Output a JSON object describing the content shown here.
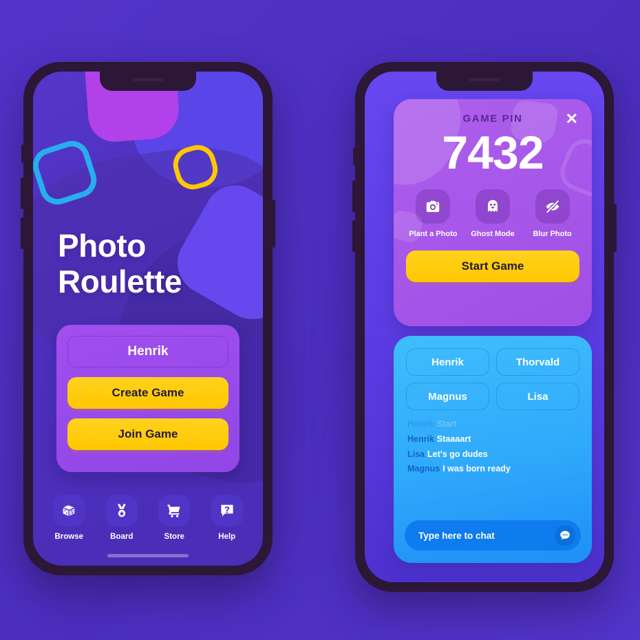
{
  "background": {
    "color": "#4E30C4"
  },
  "theme": {
    "accent_yellow": "#FFC700",
    "purple_panel": "#9B49E9",
    "chat_blue": "#2FA9FB",
    "phone_frame": "#2C1736",
    "ring_blue": "#28ADEE",
    "ring_yellow": "#FFC800",
    "blob_magenta": "#B141E8"
  },
  "left_phone": {
    "title_line1": "Photo",
    "title_line2": "Roulette",
    "panel": {
      "name_value": "Henrik",
      "name_placeholder": "Henrik",
      "create_label": "Create Game",
      "join_label": "Join Game"
    },
    "tabbar": [
      {
        "label": "Browse",
        "icon": "dice-icon"
      },
      {
        "label": "Board",
        "icon": "medal-icon"
      },
      {
        "label": "Store",
        "icon": "cart-icon"
      },
      {
        "label": "Help",
        "icon": "question-bubble-icon"
      }
    ]
  },
  "right_phone": {
    "pin_card": {
      "heading": "GAME PIN",
      "pin": "7432",
      "close_label": "✕",
      "modes": [
        {
          "label": "Plant a Photo",
          "icon": "camera-icon"
        },
        {
          "label": "Ghost Mode",
          "icon": "ghost-icon"
        },
        {
          "label": "Blur Photo",
          "icon": "eye-slash-icon"
        }
      ],
      "start_label": "Start Game"
    },
    "chat_card": {
      "players": [
        "Henrik",
        "Thorvald",
        "Magnus",
        "Lisa"
      ],
      "messages": [
        {
          "who": "Henrik",
          "text": "Start",
          "faded": true
        },
        {
          "who": "Henrik",
          "text": "Staaaart",
          "faded": false
        },
        {
          "who": "Lisa",
          "text": "Let's go dudes",
          "faded": false
        },
        {
          "who": "Magnus",
          "text": "I was born ready",
          "faded": false
        }
      ],
      "input_placeholder": "Type here to chat",
      "send_icon": "chat-bubble-icon"
    }
  }
}
